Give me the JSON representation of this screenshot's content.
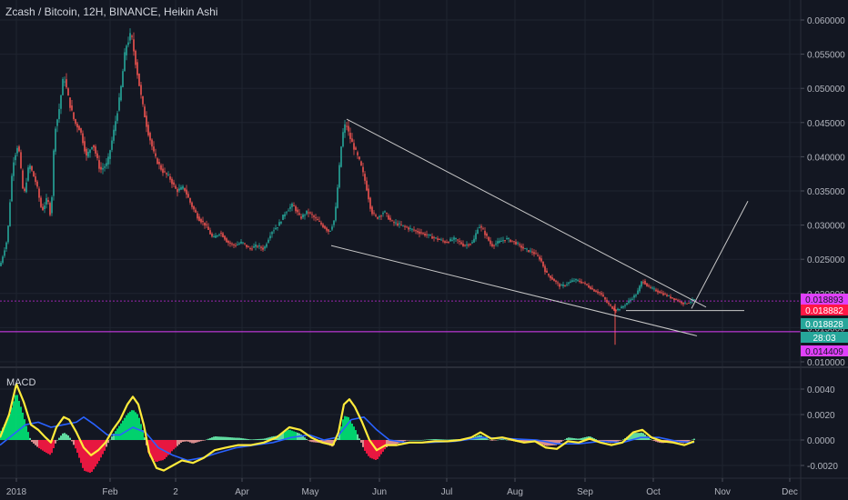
{
  "title": "Zcash / Bitcoin, 12H, BINANCE, Heikin Ashi",
  "macd_label": "MACD",
  "colors": {
    "background": "#131722",
    "grid": "#1f2430",
    "up": "#26a69a",
    "down": "#ef5350",
    "trendline": "#c8c8c8",
    "purple_line": "#9c27b0",
    "magenta_line": "#e91e63",
    "macd_line": "#ffeb3b",
    "signal_line": "#2962ff",
    "hist_pos": "#00e676",
    "hist_neg": "#ff1744"
  },
  "chart_data": [
    {
      "type": "candlestick",
      "title": "Zcash / Bitcoin, 12H, BINANCE, Heikin Ashi",
      "x_ticks": [
        "2018",
        "Feb",
        "2",
        "Apr",
        "May",
        "Jun",
        "Jul",
        "Aug",
        "Sep",
        "Oct",
        "Nov",
        "Dec"
      ],
      "ylim": [
        0.0095,
        0.0625
      ],
      "y_ticks": [
        "0.060000",
        "0.055000",
        "0.050000",
        "0.045000",
        "0.040000",
        "0.035000",
        "0.030000",
        "0.025000",
        "0.020000",
        "0.015000",
        "0.010000"
      ],
      "price_path": [
        [
          0,
          0.024
        ],
        [
          8,
          0.028
        ],
        [
          14,
          0.039
        ],
        [
          20,
          0.042
        ],
        [
          26,
          0.034
        ],
        [
          32,
          0.039
        ],
        [
          40,
          0.036
        ],
        [
          46,
          0.032
        ],
        [
          52,
          0.034
        ],
        [
          56,
          0.031
        ],
        [
          60,
          0.044
        ],
        [
          64,
          0.046
        ],
        [
          70,
          0.052
        ],
        [
          76,
          0.048
        ],
        [
          82,
          0.045
        ],
        [
          88,
          0.044
        ],
        [
          95,
          0.04
        ],
        [
          102,
          0.042
        ],
        [
          110,
          0.038
        ],
        [
          118,
          0.039
        ],
        [
          124,
          0.043
        ],
        [
          132,
          0.049
        ],
        [
          138,
          0.056
        ],
        [
          144,
          0.058
        ],
        [
          150,
          0.053
        ],
        [
          156,
          0.048
        ],
        [
          162,
          0.044
        ],
        [
          170,
          0.04
        ],
        [
          178,
          0.038
        ],
        [
          186,
          0.037
        ],
        [
          194,
          0.035
        ],
        [
          202,
          0.0355
        ],
        [
          210,
          0.033
        ],
        [
          218,
          0.031
        ],
        [
          226,
          0.03
        ],
        [
          234,
          0.028
        ],
        [
          242,
          0.029
        ],
        [
          250,
          0.0275
        ],
        [
          258,
          0.027
        ],
        [
          266,
          0.0275
        ],
        [
          274,
          0.0265
        ],
        [
          282,
          0.027
        ],
        [
          290,
          0.0265
        ],
        [
          298,
          0.029
        ],
        [
          306,
          0.03
        ],
        [
          314,
          0.032
        ],
        [
          322,
          0.033
        ],
        [
          330,
          0.031
        ],
        [
          338,
          0.032
        ],
        [
          346,
          0.031
        ],
        [
          354,
          0.03
        ],
        [
          362,
          0.029
        ],
        [
          368,
          0.031
        ],
        [
          372,
          0.037
        ],
        [
          376,
          0.043
        ],
        [
          380,
          0.045
        ],
        [
          384,
          0.043
        ],
        [
          390,
          0.041
        ],
        [
          396,
          0.039
        ],
        [
          402,
          0.036
        ],
        [
          408,
          0.032
        ],
        [
          414,
          0.031
        ],
        [
          422,
          0.032
        ],
        [
          430,
          0.0305
        ],
        [
          440,
          0.03
        ],
        [
          450,
          0.0295
        ],
        [
          460,
          0.029
        ],
        [
          470,
          0.0285
        ],
        [
          480,
          0.028
        ],
        [
          490,
          0.0275
        ],
        [
          500,
          0.028
        ],
        [
          510,
          0.027
        ],
        [
          520,
          0.0275
        ],
        [
          526,
          0.03
        ],
        [
          532,
          0.029
        ],
        [
          540,
          0.027
        ],
        [
          548,
          0.0275
        ],
        [
          556,
          0.028
        ],
        [
          566,
          0.0275
        ],
        [
          576,
          0.0265
        ],
        [
          586,
          0.026
        ],
        [
          594,
          0.025
        ],
        [
          600,
          0.023
        ],
        [
          608,
          0.022
        ],
        [
          616,
          0.021
        ],
        [
          624,
          0.0215
        ],
        [
          632,
          0.022
        ],
        [
          642,
          0.0215
        ],
        [
          652,
          0.0205
        ],
        [
          660,
          0.02
        ],
        [
          668,
          0.0185
        ],
        [
          676,
          0.0175
        ],
        [
          684,
          0.018
        ],
        [
          692,
          0.019
        ],
        [
          700,
          0.02
        ],
        [
          706,
          0.022
        ],
        [
          712,
          0.021
        ],
        [
          720,
          0.0205
        ],
        [
          728,
          0.02
        ],
        [
          736,
          0.0195
        ],
        [
          744,
          0.019
        ],
        [
          752,
          0.0185
        ],
        [
          758,
          0.0188
        ],
        [
          763,
          0.0191
        ]
      ],
      "trendlines": [
        {
          "from": [
            "May",
            0.0455
          ],
          "to": [
            "Oct",
            0.018
          ]
        },
        {
          "from": [
            "May",
            0.027
          ],
          "to": [
            "Oct",
            0.014
          ]
        },
        {
          "from": [
            "Sep",
            0.0175
          ],
          "to": [
            "Oct",
            0.0175
          ]
        },
        {
          "from": [
            "Oct",
            0.0178
          ],
          "to": [
            "Nov",
            0.0335
          ]
        }
      ],
      "price_tags": [
        {
          "value": 0.018893,
          "label": "0.018893",
          "color": "#e040fb",
          "text": "#131722"
        },
        {
          "value": 0.018882,
          "label": "0.018882",
          "color": "#ff1744",
          "text": "#ffffff"
        },
        {
          "value": 0.018828,
          "label": "0.018828",
          "color": "#26a69a",
          "text": "#ffffff"
        },
        {
          "value": 0.0172,
          "label": "28:03",
          "color": "#26a69a",
          "text": "#ffffff"
        },
        {
          "value": 0.014409,
          "label": "0.014409",
          "color": "#e040fb",
          "text": "#131722"
        }
      ],
      "horizontal_lines": [
        {
          "value": 0.018893,
          "color": "#9c27b0",
          "style": "dotted"
        },
        {
          "value": 0.014409,
          "color": "#e040fb",
          "style": "solid"
        }
      ]
    },
    {
      "type": "macd",
      "title": "MACD",
      "ylim": [
        -0.0026,
        0.0048
      ],
      "y_ticks": [
        "0.0040",
        "0.0020",
        "0.0000",
        "-0.0020"
      ],
      "macd": [
        [
          0,
          0.0002
        ],
        [
          10,
          0.002
        ],
        [
          18,
          0.0044
        ],
        [
          26,
          0.003
        ],
        [
          34,
          0.0012
        ],
        [
          42,
          0.0008
        ],
        [
          50,
          0.0002
        ],
        [
          56,
          -0.0002
        ],
        [
          62,
          0.001
        ],
        [
          70,
          0.0018
        ],
        [
          76,
          0.0016
        ],
        [
          84,
          0.0006
        ],
        [
          92,
          -0.0006
        ],
        [
          100,
          -0.0012
        ],
        [
          108,
          -0.0008
        ],
        [
          116,
          -0.0002
        ],
        [
          124,
          0.0008
        ],
        [
          132,
          0.0016
        ],
        [
          140,
          0.0028
        ],
        [
          146,
          0.0034
        ],
        [
          152,
          0.0028
        ],
        [
          158,
          0.0012
        ],
        [
          164,
          -0.001
        ],
        [
          172,
          -0.0022
        ],
        [
          180,
          -0.0024
        ],
        [
          190,
          -0.002
        ],
        [
          200,
          -0.0016
        ],
        [
          212,
          -0.0018
        ],
        [
          224,
          -0.0014
        ],
        [
          236,
          -0.0008
        ],
        [
          248,
          -0.0006
        ],
        [
          262,
          -0.0004
        ],
        [
          276,
          -0.0004
        ],
        [
          290,
          -0.0002
        ],
        [
          304,
          0.0002
        ],
        [
          318,
          0.001
        ],
        [
          330,
          0.0008
        ],
        [
          342,
          0.0002
        ],
        [
          354,
          -0.0002
        ],
        [
          366,
          -0.0004
        ],
        [
          372,
          0.0006
        ],
        [
          378,
          0.0028
        ],
        [
          384,
          0.0032
        ],
        [
          390,
          0.0026
        ],
        [
          398,
          0.0014
        ],
        [
          406,
          0.0
        ],
        [
          414,
          -0.0008
        ],
        [
          424,
          -0.0004
        ],
        [
          436,
          -0.0004
        ],
        [
          450,
          -0.0002
        ],
        [
          464,
          -0.0002
        ],
        [
          478,
          -0.0001
        ],
        [
          492,
          -0.0001
        ],
        [
          506,
          0.0
        ],
        [
          518,
          0.0002
        ],
        [
          528,
          0.0006
        ],
        [
          540,
          0.0001
        ],
        [
          552,
          0.0002
        ],
        [
          564,
          0.0
        ],
        [
          576,
          -0.0002
        ],
        [
          588,
          -0.0001
        ],
        [
          600,
          -0.0006
        ],
        [
          612,
          -0.0007
        ],
        [
          624,
          -0.0001
        ],
        [
          636,
          -0.0002
        ],
        [
          648,
          0.0001
        ],
        [
          660,
          -0.0002
        ],
        [
          672,
          -0.0004
        ],
        [
          684,
          -0.0002
        ],
        [
          696,
          0.0006
        ],
        [
          706,
          0.0008
        ],
        [
          716,
          0.0002
        ],
        [
          728,
          -0.0001
        ],
        [
          740,
          -0.0002
        ],
        [
          752,
          -0.0004
        ],
        [
          763,
          -0.0001
        ]
      ],
      "signal": [
        [
          0,
          -0.0004
        ],
        [
          14,
          0.0004
        ],
        [
          28,
          0.0012
        ],
        [
          42,
          0.0014
        ],
        [
          56,
          0.001
        ],
        [
          70,
          0.0012
        ],
        [
          84,
          0.0014
        ],
        [
          92,
          0.0018
        ],
        [
          104,
          0.0012
        ],
        [
          118,
          0.0004
        ],
        [
          132,
          0.0004
        ],
        [
          146,
          0.001
        ],
        [
          160,
          0.0006
        ],
        [
          174,
          -0.0006
        ],
        [
          190,
          -0.0012
        ],
        [
          206,
          -0.0016
        ],
        [
          222,
          -0.0014
        ],
        [
          240,
          -0.001
        ],
        [
          260,
          -0.0006
        ],
        [
          280,
          -0.0004
        ],
        [
          300,
          -0.0002
        ],
        [
          320,
          0.0002
        ],
        [
          340,
          0.0004
        ],
        [
          356,
          0.0
        ],
        [
          370,
          0.0002
        ],
        [
          386,
          0.0016
        ],
        [
          400,
          0.0018
        ],
        [
          414,
          0.0008
        ],
        [
          428,
          0.0
        ],
        [
          446,
          -0.0002
        ],
        [
          470,
          -0.0002
        ],
        [
          500,
          -0.0001
        ],
        [
          530,
          0.0002
        ],
        [
          560,
          0.0001
        ],
        [
          590,
          0.0
        ],
        [
          612,
          -0.0003
        ],
        [
          636,
          -0.0003
        ],
        [
          660,
          -0.0001
        ],
        [
          684,
          -0.0002
        ],
        [
          704,
          0.0002
        ],
        [
          724,
          0.0002
        ],
        [
          744,
          -0.0001
        ],
        [
          763,
          -0.0002
        ]
      ]
    }
  ]
}
